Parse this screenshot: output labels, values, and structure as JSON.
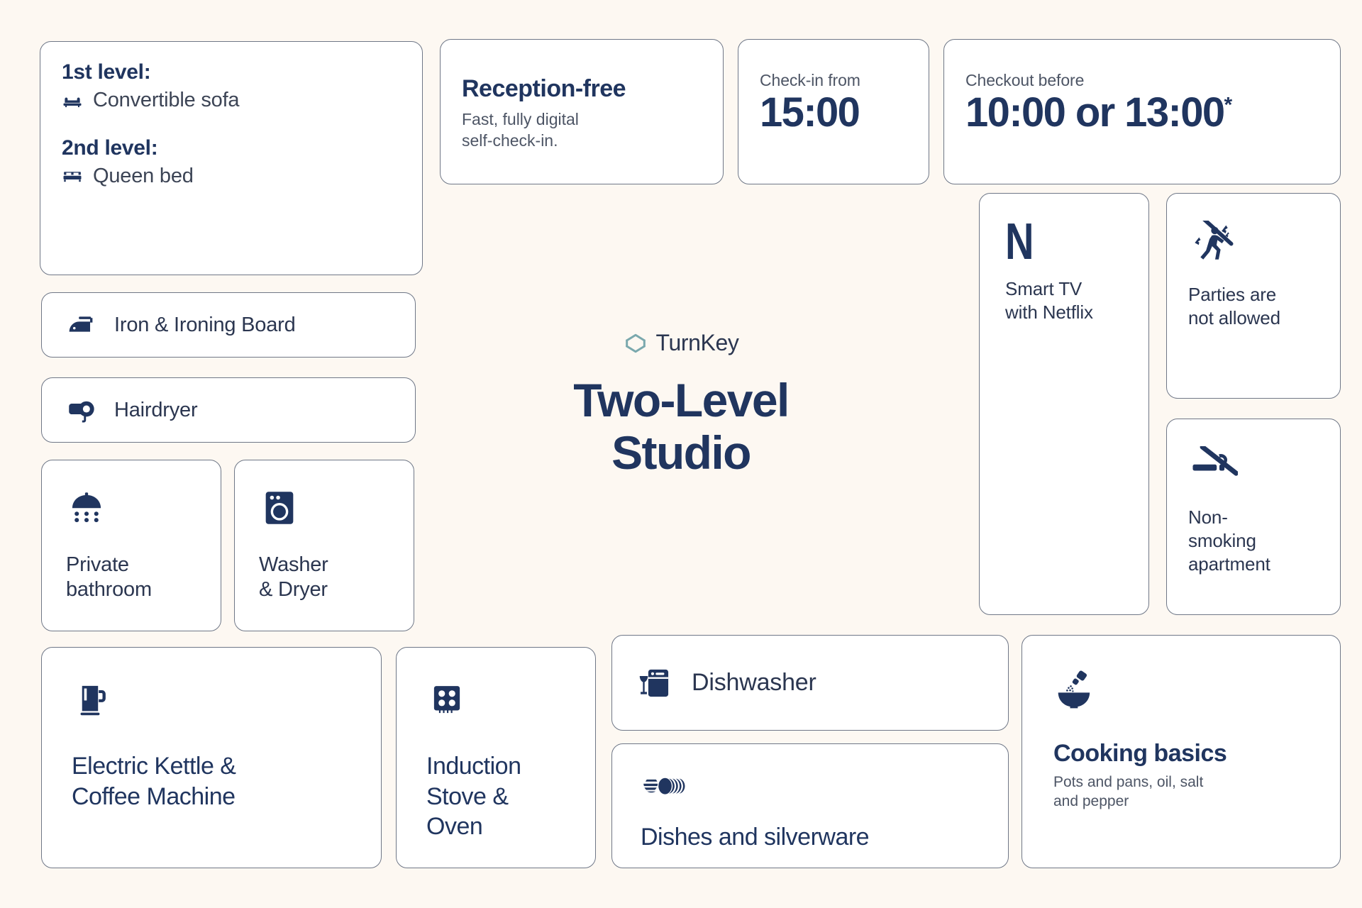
{
  "brand": {
    "logo_icon": "hexagon-logo-icon",
    "name": "TurnKey",
    "title_line1": "Two-Level",
    "title_line2": "Studio",
    "logo_color": "#7aa8ad",
    "navy": "#20355f"
  },
  "sleeping": {
    "level1_head": "1st level:",
    "level1_item": "Convertible sofa",
    "level1_icon": "sofa-icon",
    "level2_head": "2nd level:",
    "level2_item": "Queen bed",
    "level2_icon": "bed-icon"
  },
  "reception": {
    "title": "Reception-free",
    "subtitle_line1": "Fast, fully digital",
    "subtitle_line2": "self-check-in."
  },
  "checkin": {
    "label": "Check-in from",
    "time": "15:00"
  },
  "checkout": {
    "label": "Checkout before",
    "time": "10:00 or 13:00",
    "asterisk": "*"
  },
  "amenities": {
    "iron": {
      "label": "Iron & Ironing Board",
      "icon": "iron-icon"
    },
    "hairdryer": {
      "label": "Hairdryer",
      "icon": "hairdryer-icon"
    },
    "bathroom": {
      "label_line1": "Private",
      "label_line2": "bathroom",
      "icon": "shower-icon"
    },
    "laundry": {
      "label_line1": "Washer",
      "label_line2": "& Dryer",
      "icon": "washing-machine-icon"
    },
    "kettle": {
      "label_line1": "Electric Kettle &",
      "label_line2": "Coffee Machine",
      "icon": "kettle-icon"
    },
    "stove": {
      "label_line1": "Induction",
      "label_line2": "Stove &",
      "label_line3": "Oven",
      "icon": "cooktop-icon"
    },
    "dishwasher": {
      "label": "Dishwasher",
      "icon": "dishwasher-icon"
    },
    "dishes": {
      "label": "Dishes and silverware",
      "icon": "plates-icon"
    },
    "cooking": {
      "label": "Cooking basics",
      "sub_line1": "Pots and pans, oil, salt",
      "sub_line2": "and pepper",
      "icon": "mortar-seasoning-icon"
    },
    "tv": {
      "logo_letter": "N",
      "label_line1": "Smart TV",
      "label_line2": "with Netflix",
      "icon": "netflix-n-icon"
    }
  },
  "rules": {
    "parties": {
      "label_line1": "Parties are",
      "label_line2": "not allowed",
      "icon": "no-parties-icon"
    },
    "smoking": {
      "label_line1": "Non-",
      "label_line2": "smoking",
      "label_line3": "apartment",
      "icon": "no-smoking-icon"
    }
  }
}
